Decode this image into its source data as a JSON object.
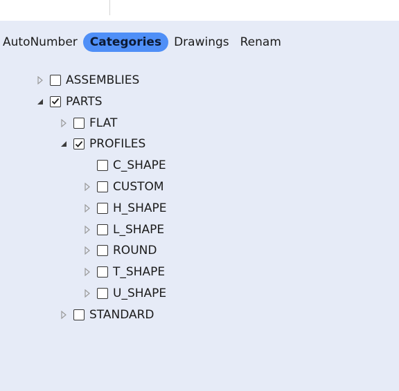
{
  "tabs": [
    {
      "label": "AutoNumber",
      "active": false
    },
    {
      "label": "Categories",
      "active": true
    },
    {
      "label": "Drawings",
      "active": false
    },
    {
      "label": "Renam",
      "active": false
    }
  ],
  "tree": [
    {
      "label": "ASSEMBLIES",
      "depth": 0,
      "expander": "collapsed",
      "checked": false
    },
    {
      "label": "PARTS",
      "depth": 0,
      "expander": "expanded",
      "checked": true
    },
    {
      "label": "FLAT",
      "depth": 1,
      "expander": "collapsed",
      "checked": false
    },
    {
      "label": "PROFILES",
      "depth": 1,
      "expander": "expanded",
      "checked": true
    },
    {
      "label": "C_SHAPE",
      "depth": 2,
      "expander": "none",
      "checked": false
    },
    {
      "label": "CUSTOM",
      "depth": 2,
      "expander": "collapsed",
      "checked": false
    },
    {
      "label": "H_SHAPE",
      "depth": 2,
      "expander": "collapsed",
      "checked": false
    },
    {
      "label": "L_SHAPE",
      "depth": 2,
      "expander": "collapsed",
      "checked": false
    },
    {
      "label": "ROUND",
      "depth": 2,
      "expander": "collapsed",
      "checked": false
    },
    {
      "label": "T_SHAPE",
      "depth": 2,
      "expander": "collapsed",
      "checked": false
    },
    {
      "label": "U_SHAPE",
      "depth": 2,
      "expander": "collapsed",
      "checked": false
    },
    {
      "label": "STANDARD",
      "depth": 1,
      "expander": "collapsed",
      "checked": false
    }
  ],
  "colors": {
    "panel_bg": "#e6ebf7",
    "tab_active_bg": "#4f8ff7",
    "text": "#1b1b1b"
  },
  "icons": {
    "collapsed": "triangle-right-outline-icon",
    "expanded": "triangle-down-filled-icon",
    "check": "checkmark-icon"
  }
}
